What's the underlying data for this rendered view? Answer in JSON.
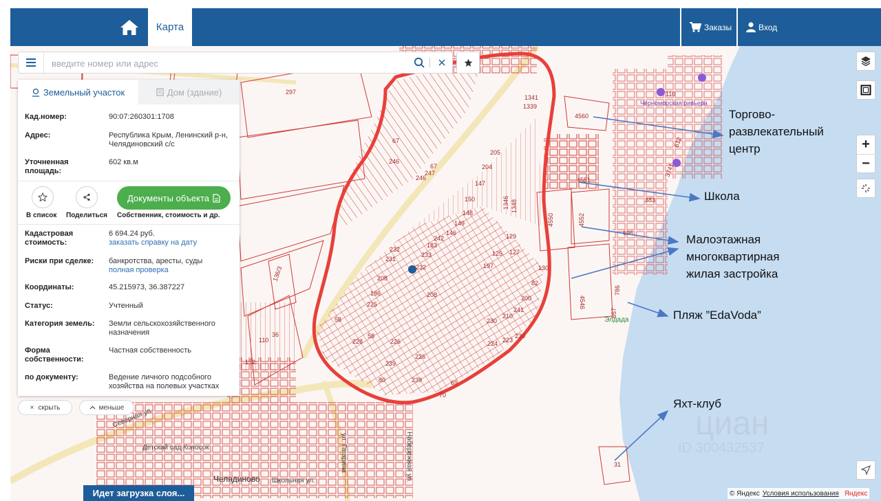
{
  "header": {
    "tab_label": "Карта",
    "orders_label": "Заказы",
    "login_label": "Вход",
    "bg_color": "#1d5d99"
  },
  "search": {
    "placeholder": "введите номер или адрес"
  },
  "panel": {
    "tabs": [
      {
        "label": "Земельный участок",
        "active": true,
        "icon": "pin-icon"
      },
      {
        "label": "Дом (здание)",
        "active": false,
        "icon": "building-icon"
      }
    ],
    "cad_number": {
      "label": "Кад.номер:",
      "value": "90:07:260301:1708"
    },
    "address": {
      "label": "Адрес:",
      "value": "Республика Крым, Ленинский р-н, Челядиновский с/с"
    },
    "area": {
      "label": "Уточненная площадь:",
      "value": "602 кв.м"
    },
    "actions": {
      "add_to_list": "В список",
      "share": "Поделиться",
      "documents": "Документы объекта",
      "documents_sub": "Собственник, стоимость и др."
    },
    "cad_cost": {
      "label": "Кадастровая стоимость:",
      "value": "6 694.24 руб.",
      "link": "заказать справку на дату"
    },
    "risks": {
      "label": "Риски при сделке:",
      "value": "банкротства, аресты, суды",
      "link": "полная проверка"
    },
    "coords": {
      "label": "Координаты:",
      "value": "45.215973, 36.387227"
    },
    "status": {
      "label": "Статус:",
      "value": "Учтенный"
    },
    "category": {
      "label": "Категория земель:",
      "value": "Земли сельскохозяйственного назначения"
    },
    "ownership": {
      "label": "Форма собственности:",
      "value": "Частная собственность"
    },
    "by_document": {
      "label": "по документу:",
      "value": "Ведение личного подсобного хозяйства на полевых участках"
    }
  },
  "controls": {
    "hide_label": "скрыть",
    "less_label": "меньше",
    "loading_text": "Идет загрузка слоя...",
    "copyright": "© Яндекс",
    "terms": "Условия использования",
    "brand": "Яндекс"
  },
  "annotations": {
    "mall": [
      "Торгово-",
      "развлекательный",
      "центр"
    ],
    "school": "Школа",
    "housing": [
      "Малоэтажная",
      "многоквартирная",
      "жилая застройка"
    ],
    "beach": "Пляж ”EdaVoda”",
    "yacht": "Яхт-клуб"
  },
  "map_labels": {
    "street_severnaya": "Северная ул.",
    "street_gagarina": "ул. Гагарина",
    "street_naberezhnaya": "Набережная ул.",
    "street_shkolnaya": "Школьная ул.",
    "village": "Челядиново",
    "kindergarten": "Детский сад Колосок",
    "eldada": "Элдада",
    "chernomorskaya": "Черноморская ривьера",
    "watermark": "циан",
    "watermark_id": "ID 300432537"
  },
  "parcel_numbers": [
    "297",
    "1341",
    "1339",
    "4560",
    "4551",
    "4550",
    "4552",
    "4546",
    "110",
    "612",
    "3741",
    "383",
    "696",
    "786",
    "657",
    "67",
    "246",
    "247",
    "205",
    "204",
    "147",
    "150",
    "148",
    "149",
    "183",
    "242",
    "233",
    "232",
    "208",
    "206",
    "186",
    "225",
    "58",
    "228",
    "226",
    "239",
    "80",
    "69",
    "70",
    "125",
    "197",
    "129",
    "127",
    "130",
    "82",
    "200",
    "241",
    "210",
    "230",
    "223",
    "224",
    "1346",
    "1348",
    "136/3",
    "110",
    "36",
    "152",
    "31"
  ],
  "colors": {
    "map_bg": "#fbf6f4",
    "parcel_line": "#cf3a36",
    "outline": "#e8403a",
    "sea": "#c6dcf1",
    "selected_point": "#1d5d99",
    "arrow": "#4a78c2"
  }
}
